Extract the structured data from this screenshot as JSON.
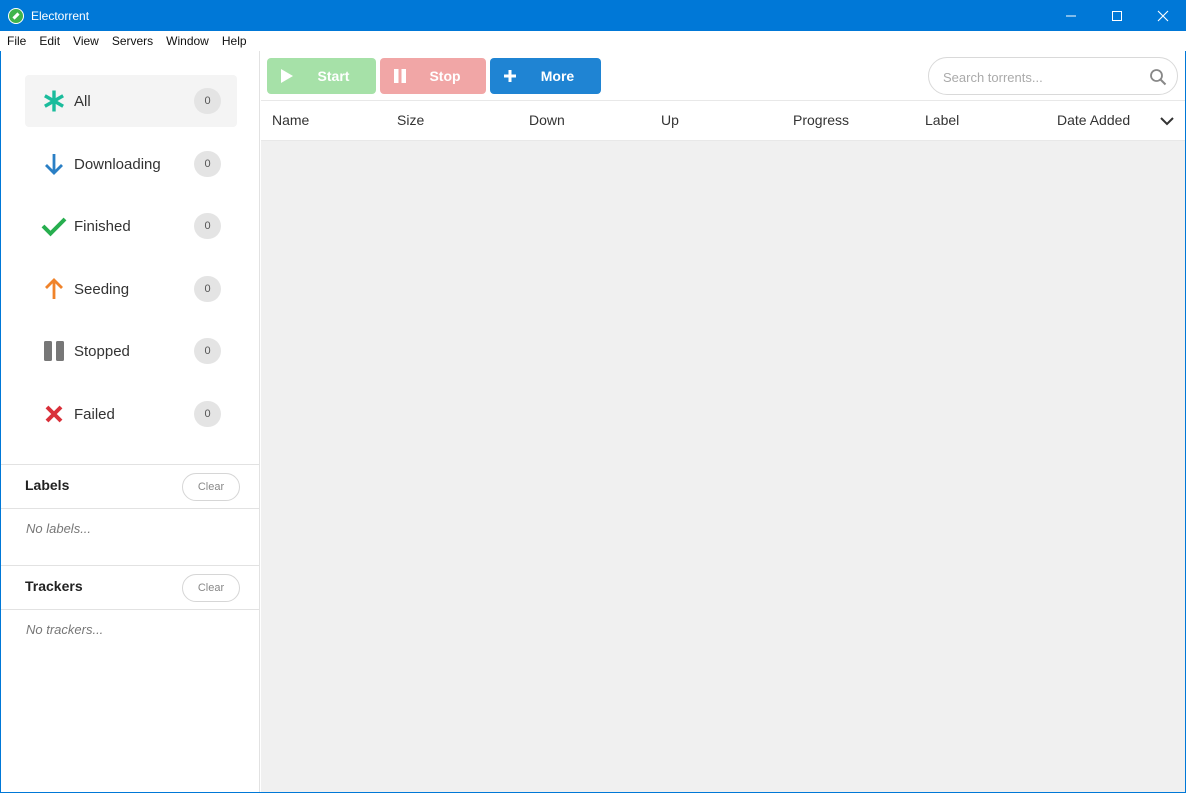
{
  "window": {
    "title": "Electorrent",
    "controls": [
      "minimize-icon",
      "maximize-icon",
      "close-icon"
    ],
    "accent_color": "#0078d7"
  },
  "menu": {
    "items": [
      "File",
      "Edit",
      "View",
      "Servers",
      "Window",
      "Help"
    ]
  },
  "sidebar": {
    "statuses": [
      {
        "label": "All",
        "count": "0",
        "icon": "asterisk-icon",
        "color": "#1abc9c",
        "active": true
      },
      {
        "label": "Downloading",
        "count": "0",
        "icon": "arrow-down-icon",
        "color": "#2a7fc5",
        "active": false
      },
      {
        "label": "Finished",
        "count": "0",
        "icon": "checkmark-icon",
        "color": "#27ae4f",
        "active": false
      },
      {
        "label": "Seeding",
        "count": "0",
        "icon": "arrow-up-icon",
        "color": "#f0832a",
        "active": false
      },
      {
        "label": "Stopped",
        "count": "0",
        "icon": "pause-icon",
        "color": "#777777",
        "active": false
      },
      {
        "label": "Failed",
        "count": "0",
        "icon": "cross-icon",
        "color": "#d9303a",
        "active": false
      }
    ],
    "labels": {
      "title": "Labels",
      "clear_label": "Clear",
      "empty_text": "No labels..."
    },
    "trackers": {
      "title": "Trackers",
      "clear_label": "Clear",
      "empty_text": "No trackers..."
    }
  },
  "toolbar": {
    "start_label": "Start",
    "stop_label": "Stop",
    "more_label": "More",
    "start_color": "#a6e1a8",
    "stop_color": "#f1a6a6",
    "more_color": "#1f84d3"
  },
  "search": {
    "placeholder": "Search torrents..."
  },
  "table": {
    "columns": [
      "Name",
      "Size",
      "Down",
      "Up",
      "Progress",
      "Label",
      "Date Added"
    ],
    "sort_icon": "chevron-down-icon",
    "rows": []
  }
}
